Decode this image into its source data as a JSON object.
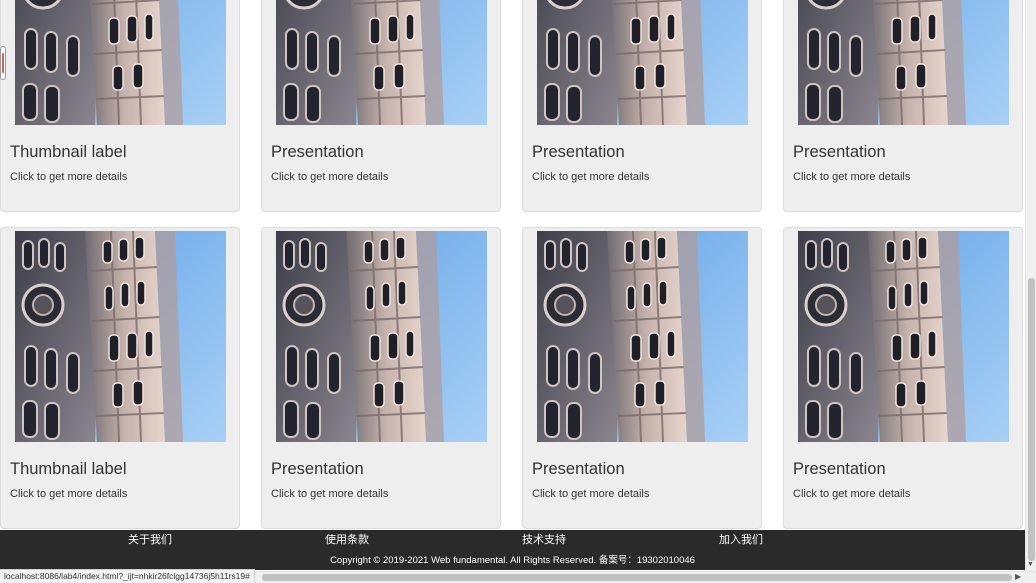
{
  "cards": [
    {
      "title": "Thumbnail label",
      "description": "Click to get more details"
    },
    {
      "title": "Presentation",
      "description": "Click to get more details"
    },
    {
      "title": "Presentation",
      "description": "Click to get more details"
    },
    {
      "title": "Presentation",
      "description": "Click to get more details"
    },
    {
      "title": "Thumbnail label",
      "description": "Click to get more details"
    },
    {
      "title": "Presentation",
      "description": "Click to get more details"
    },
    {
      "title": "Presentation",
      "description": "Click to get more details"
    },
    {
      "title": "Presentation",
      "description": "Click to get more details"
    }
  ],
  "footer": {
    "links": [
      "关于我们",
      "使用条款",
      "技术支持",
      "加入我们"
    ],
    "copyright": "Copyright © 2019-2021 Web fundamental. All Rights Reserved. 备案号：19302010046"
  },
  "status_url": "localhost:8086/lab4/index.html?_ijt=nhkir26fclgg14736j5h11rs19#",
  "colors": {
    "card_bg": "#eeeeee",
    "footer_bg": "#2a2a2a",
    "sky": "#7ab3ea"
  }
}
